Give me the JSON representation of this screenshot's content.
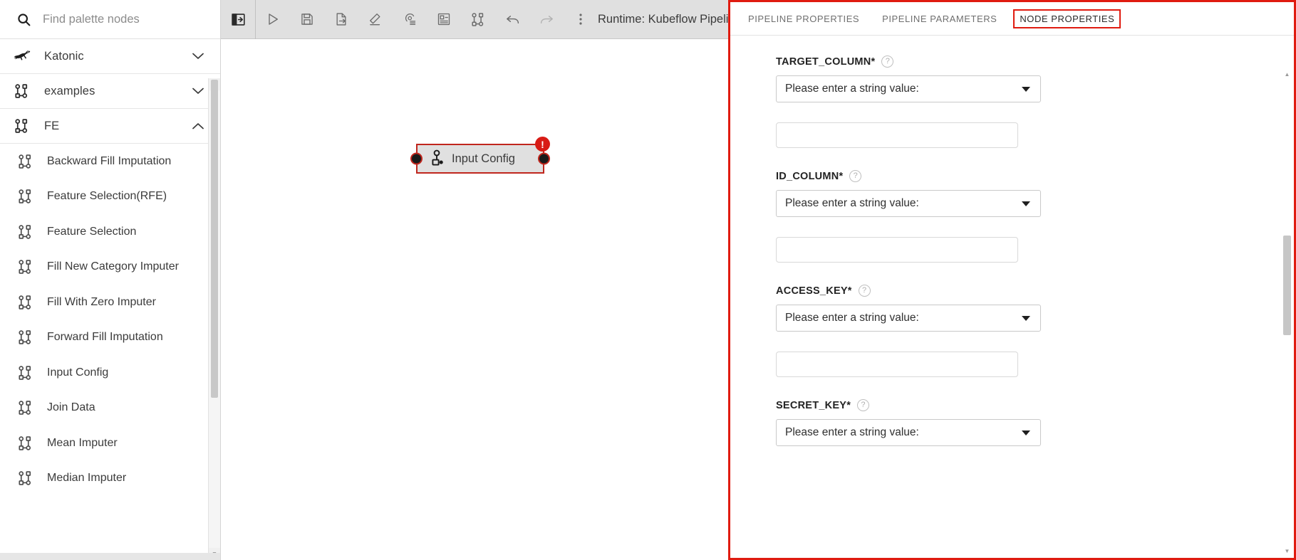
{
  "palette": {
    "search": {
      "placeholder": "Find palette nodes",
      "value": "",
      "icon": "search-icon"
    },
    "categories": [
      {
        "label": "Katonic",
        "icon": "kangaroo-icon",
        "expanded": false,
        "chevron": "chevron-down-icon"
      },
      {
        "label": "examples",
        "icon": "node-graph-icon",
        "expanded": false,
        "chevron": "chevron-down-icon"
      },
      {
        "label": "FE",
        "icon": "node-graph-icon",
        "expanded": true,
        "chevron": "chevron-up-icon"
      }
    ],
    "nodes": [
      {
        "label": "Backward Fill Imputation",
        "icon": "node-graph-icon"
      },
      {
        "label": "Feature Selection(RFE)",
        "icon": "node-graph-icon"
      },
      {
        "label": "Feature Selection",
        "icon": "node-graph-icon"
      },
      {
        "label": "Fill New Category Imputer",
        "icon": "node-graph-icon"
      },
      {
        "label": "Fill With Zero Imputer",
        "icon": "node-graph-icon"
      },
      {
        "label": "Forward Fill Imputation",
        "icon": "node-graph-icon"
      },
      {
        "label": "Input Config",
        "icon": "node-graph-icon"
      },
      {
        "label": "Join Data",
        "icon": "node-graph-icon"
      },
      {
        "label": "Mean Imputer",
        "icon": "node-graph-icon"
      },
      {
        "label": "Median Imputer",
        "icon": "node-graph-icon"
      }
    ]
  },
  "toolbar": {
    "buttons": [
      {
        "name": "toggle-palette-button",
        "icon": "panel-open-icon",
        "tooltip": "Open panel"
      },
      {
        "name": "run-pipeline-button",
        "icon": "play-icon",
        "tooltip": "Run pipeline"
      },
      {
        "name": "save-pipeline-button",
        "icon": "save-icon",
        "tooltip": "Save pipeline"
      },
      {
        "name": "export-pipeline-button",
        "icon": "export-icon",
        "tooltip": "Export pipeline"
      },
      {
        "name": "clear-pipeline-button",
        "icon": "eraser-icon",
        "tooltip": "Clear pipeline"
      },
      {
        "name": "pipeline-properties-button",
        "icon": "gear-list-icon",
        "tooltip": "Open pipeline properties"
      },
      {
        "name": "add-comment-button",
        "icon": "add-comment-icon",
        "tooltip": "Add comment"
      },
      {
        "name": "arrange-layout-button",
        "icon": "node-graph-icon",
        "tooltip": "Arrange layout"
      },
      {
        "name": "undo-button",
        "icon": "undo-icon",
        "tooltip": "Undo"
      },
      {
        "name": "redo-button",
        "icon": "redo-icon",
        "tooltip": "Redo"
      },
      {
        "name": "overflow-menu-button",
        "icon": "kebab-menu-icon",
        "tooltip": "More actions"
      }
    ],
    "runtime_label": "Runtime: Kubeflow Pipelines",
    "toggle_properties": {
      "name": "toggle-properties-button",
      "icon": "panel-open-icon"
    }
  },
  "canvas": {
    "node": {
      "label": "Input Config",
      "icon": "node-person-icon",
      "has_error": true,
      "error_symbol": "!",
      "border_color": "#c0261d",
      "fill_color": "#e0e0e0"
    }
  },
  "properties": {
    "tabs": [
      {
        "label": "PIPELINE PROPERTIES",
        "active": false
      },
      {
        "label": "PIPELINE PARAMETERS",
        "active": false
      },
      {
        "label": "NODE PROPERTIES",
        "active": true
      }
    ],
    "highlight_color": "#e01b10",
    "fields": [
      {
        "label": "TARGET_COLUMN*",
        "help": "?",
        "select_value": "Please enter a string value:",
        "input_value": "",
        "input_placeholder": ""
      },
      {
        "label": "ID_COLUMN*",
        "help": "?",
        "select_value": "Please enter a string value:",
        "input_value": "",
        "input_placeholder": ""
      },
      {
        "label": "ACCESS_KEY*",
        "help": "?",
        "select_value": "Please enter a string value:",
        "input_value": "",
        "input_placeholder": ""
      },
      {
        "label": "SECRET_KEY*",
        "help": "?",
        "select_value": "Please enter a string value:",
        "input_value": "",
        "input_placeholder": ""
      }
    ]
  }
}
